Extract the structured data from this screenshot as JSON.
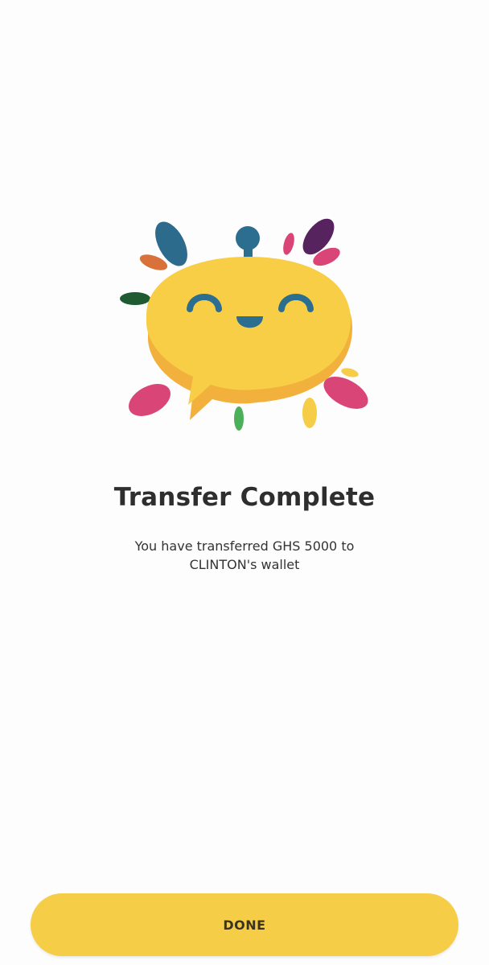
{
  "success": {
    "title": "Transfer Complete",
    "message": "You have transferred GHS 5000 to CLINTON's wallet"
  },
  "actions": {
    "done_label": "DONE"
  },
  "colors": {
    "accent": "#f6cd46",
    "mascot_body": "#f7ce45",
    "mascot_shadow": "#f2b03c",
    "mascot_features": "#2b6e8f",
    "text_primary": "#2e2e2e"
  },
  "illustration": {
    "icon": "happy-chat-bubble-mascot-icon"
  }
}
